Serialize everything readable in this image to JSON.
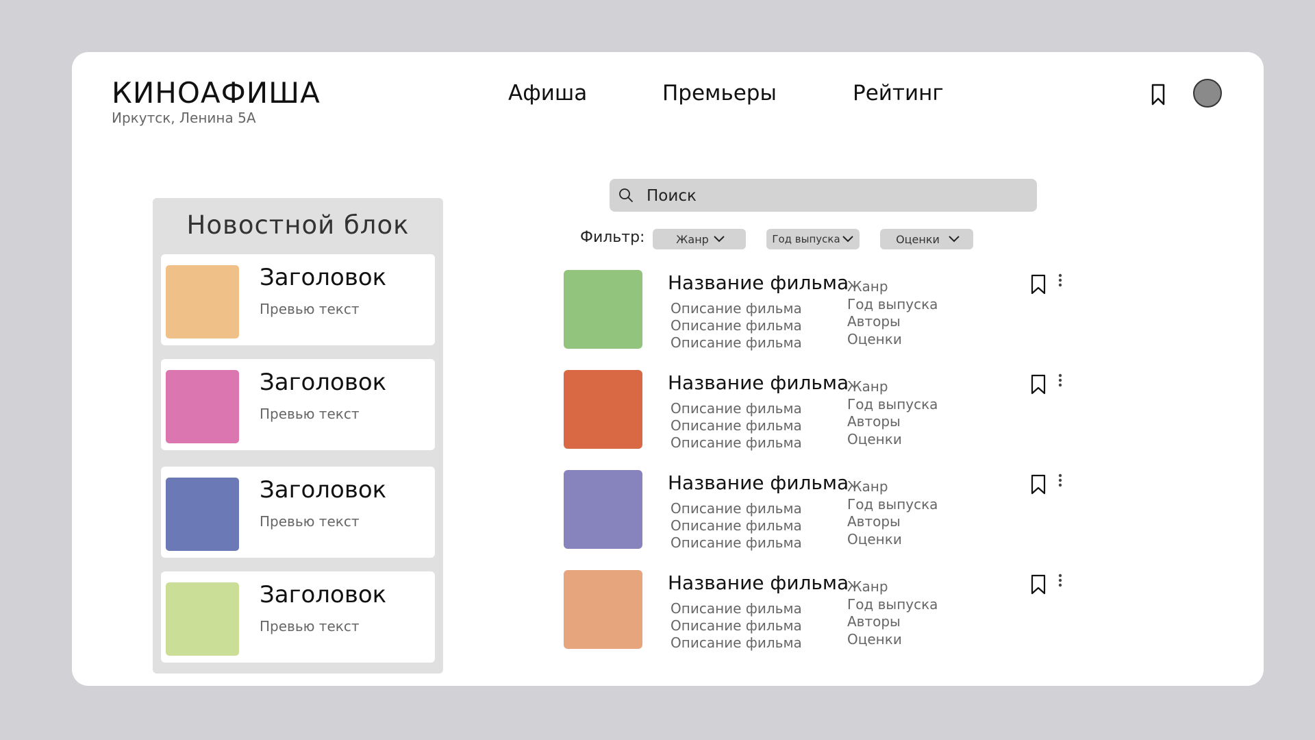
{
  "header": {
    "title": "КИНОАФИША",
    "address": "Иркутск, Ленина 5А",
    "nav": [
      "Афиша",
      "Премьеры",
      "Рейтинг"
    ],
    "icons": [
      "bookmark-icon",
      "avatar"
    ]
  },
  "news": {
    "title": "Новостной блок",
    "items": [
      {
        "heading": "Заголовок",
        "preview": "Превью текст",
        "color": "#f0c089"
      },
      {
        "heading": "Заголовок",
        "preview": "Превью текст",
        "color": "#dc76b0"
      },
      {
        "heading": "Заголовок",
        "preview": "Превью текст",
        "color": "#6b79b6"
      },
      {
        "heading": "Заголовок",
        "preview": "Превью текст",
        "color": "#cade97"
      }
    ]
  },
  "search": {
    "placeholder": "Поиск"
  },
  "filter": {
    "label": "Фильтр:",
    "options": [
      "Жанр",
      "Год выпуска",
      "Оценки"
    ]
  },
  "movies": [
    {
      "title": "Название фильма",
      "desc": [
        "Описание фильма",
        "Описание фильма",
        "Описание фильма"
      ],
      "meta": [
        "Жанр",
        "Год выпуска",
        "Авторы",
        "Оценки"
      ],
      "color": "#93c47d"
    },
    {
      "title": "Название фильма",
      "desc": [
        "Описание фильма",
        "Описание фильма",
        "Описание фильма"
      ],
      "meta": [
        "Жанр",
        "Год выпуска",
        "Авторы",
        "Оценки"
      ],
      "color": "#d96944"
    },
    {
      "title": "Название фильма",
      "desc": [
        "Описание фильма",
        "Описание фильма",
        "Описание фильма"
      ],
      "meta": [
        "Жанр",
        "Год выпуска",
        "Авторы",
        "Оценки"
      ],
      "color": "#8784bd"
    },
    {
      "title": "Название фильма",
      "desc": [
        "Описание фильма",
        "Описание фильма",
        "Описание фильма"
      ],
      "meta": [
        "Жанр",
        "Год выпуска",
        "Авторы",
        "Оценки"
      ],
      "color": "#e7a57e"
    }
  ]
}
